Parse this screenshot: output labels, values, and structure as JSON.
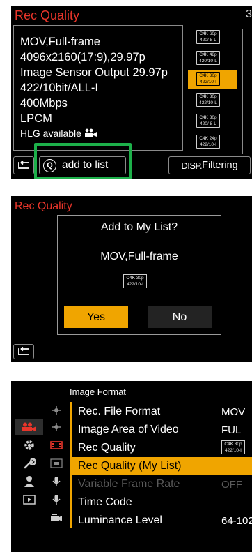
{
  "panel1": {
    "title": "Rec Quality",
    "page_indicator": "3",
    "info_lines": [
      "MOV,Full-frame",
      "4096x2160(17:9),29.97p",
      "Image Sensor Output 29.97p",
      "422/10bit/ALL-I",
      "400Mbps",
      "LPCM",
      "HLG available"
    ],
    "formats": [
      {
        "line1": "C4K 60p",
        "line2": "420/ 8-L",
        "selected": false
      },
      {
        "line1": "C4K 48p",
        "line2": "420/10-L",
        "selected": false
      },
      {
        "line1": "C4K 30p",
        "line2": "422/10-I",
        "selected": true
      },
      {
        "line1": "C4K 30p",
        "line2": "422/10-L",
        "selected": false
      },
      {
        "line1": "C4K 30p",
        "line2": "420/ 8-L",
        "selected": false
      },
      {
        "line1": "C4K 24p",
        "line2": "422/10-I",
        "selected": false
      }
    ],
    "q_button_label": "add to list",
    "q_key": "Q",
    "disp_prefix": "DISP.",
    "disp_label": "Filtering"
  },
  "panel2": {
    "title": "Rec Quality",
    "dialog_title": "Add to My List?",
    "dialog_subtitle": "MOV,Full-frame",
    "badge_line1": "C4K 30p",
    "badge_line2": "422/10-I",
    "yes_label": "Yes",
    "no_label": "No"
  },
  "panel3": {
    "section_title": "Image Format",
    "items": [
      {
        "label": "Rec. File Format",
        "value": "MOV",
        "selected": false,
        "disabled": false
      },
      {
        "label": "Image Area of Video",
        "value": "FUL",
        "selected": false,
        "disabled": false
      },
      {
        "label": "Rec Quality",
        "value": "",
        "badge1": "C4K 30p",
        "badge2": "422/10-I",
        "selected": false,
        "disabled": false
      },
      {
        "label": "Rec Quality (My List)",
        "value": "",
        "selected": true,
        "disabled": false
      },
      {
        "label": "Variable Frame Rate",
        "value": "OFF",
        "selected": false,
        "disabled": true
      },
      {
        "label": "Time Code",
        "value": "",
        "selected": false,
        "disabled": false
      },
      {
        "label": "Luminance Level",
        "value": "64-102",
        "selected": false,
        "disabled": false
      }
    ]
  },
  "colors": {
    "accent": "#f0a500",
    "title_red": "#e8352a",
    "highlight_green": "#1db04a"
  }
}
